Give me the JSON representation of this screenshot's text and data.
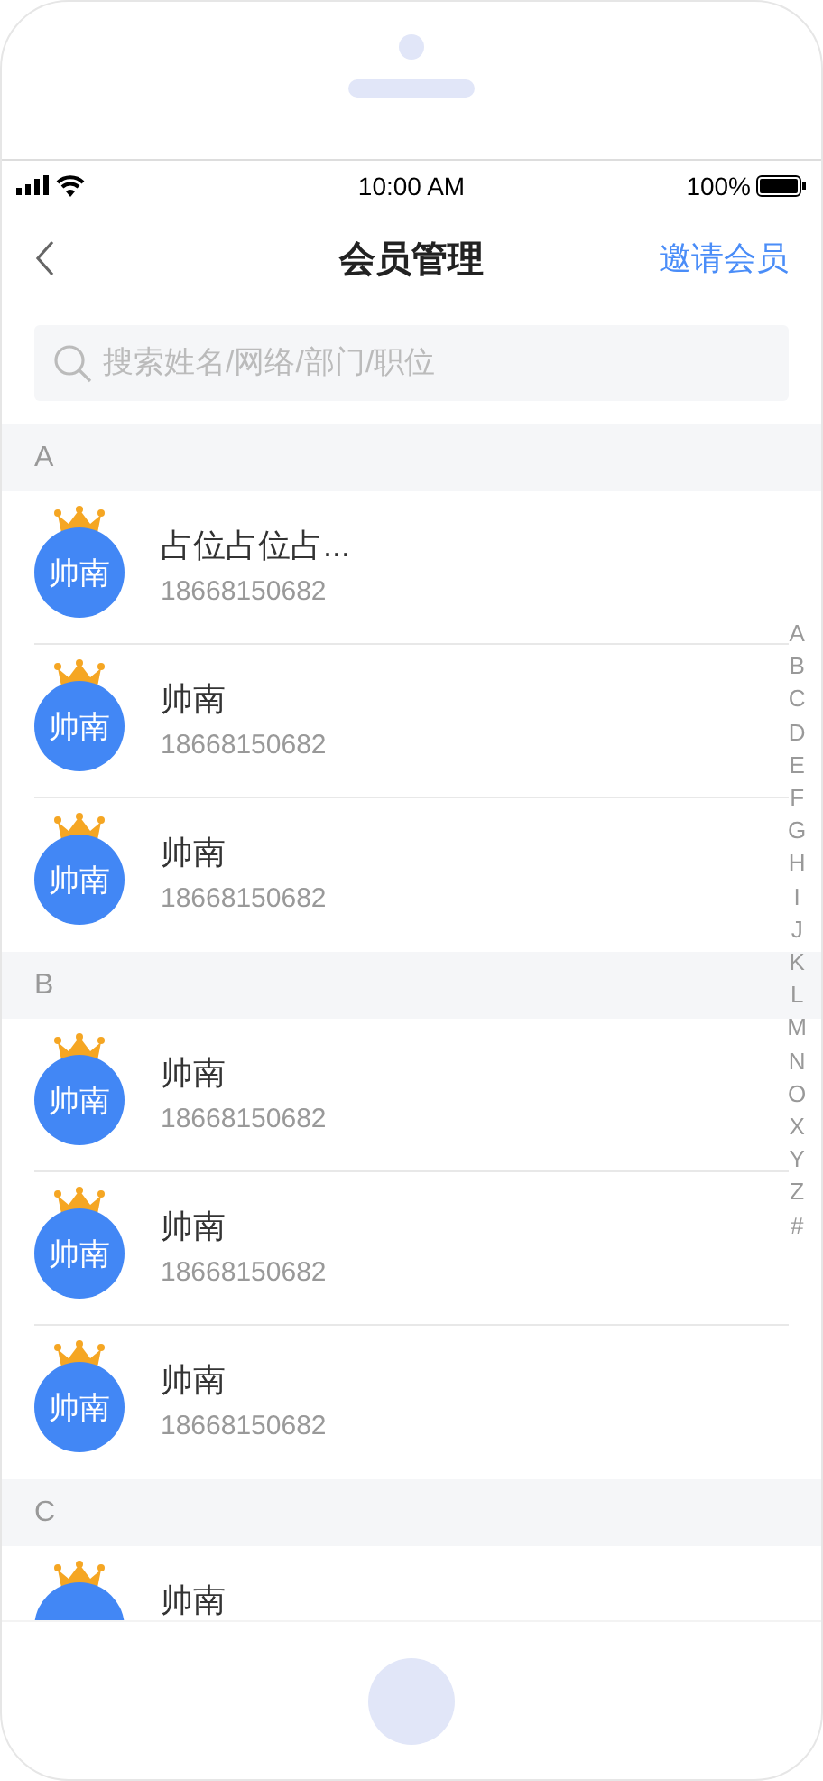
{
  "status_bar": {
    "time": "10:00 AM",
    "battery": "100%"
  },
  "nav": {
    "title": "会员管理",
    "action": "邀请会员"
  },
  "search": {
    "placeholder": "搜索姓名/网络/部门/职位"
  },
  "sections": [
    {
      "letter": "A",
      "members": [
        {
          "avatar_text": "帅南",
          "name": "占位占位占...",
          "phone": "18668150682"
        },
        {
          "avatar_text": "帅南",
          "name": "帅南",
          "phone": "18668150682"
        },
        {
          "avatar_text": "帅南",
          "name": "帅南",
          "phone": "18668150682"
        }
      ]
    },
    {
      "letter": "B",
      "members": [
        {
          "avatar_text": "帅南",
          "name": "帅南",
          "phone": "18668150682"
        },
        {
          "avatar_text": "帅南",
          "name": "帅南",
          "phone": "18668150682"
        },
        {
          "avatar_text": "帅南",
          "name": "帅南",
          "phone": "18668150682"
        }
      ]
    },
    {
      "letter": "C",
      "members": [
        {
          "name": "帅南"
        }
      ]
    }
  ],
  "index_bar": [
    "A",
    "B",
    "C",
    "D",
    "E",
    "F",
    "G",
    "H",
    "I",
    "J",
    "K",
    "L",
    "M",
    "N",
    "O",
    "X",
    "Y",
    "Z",
    "#"
  ]
}
